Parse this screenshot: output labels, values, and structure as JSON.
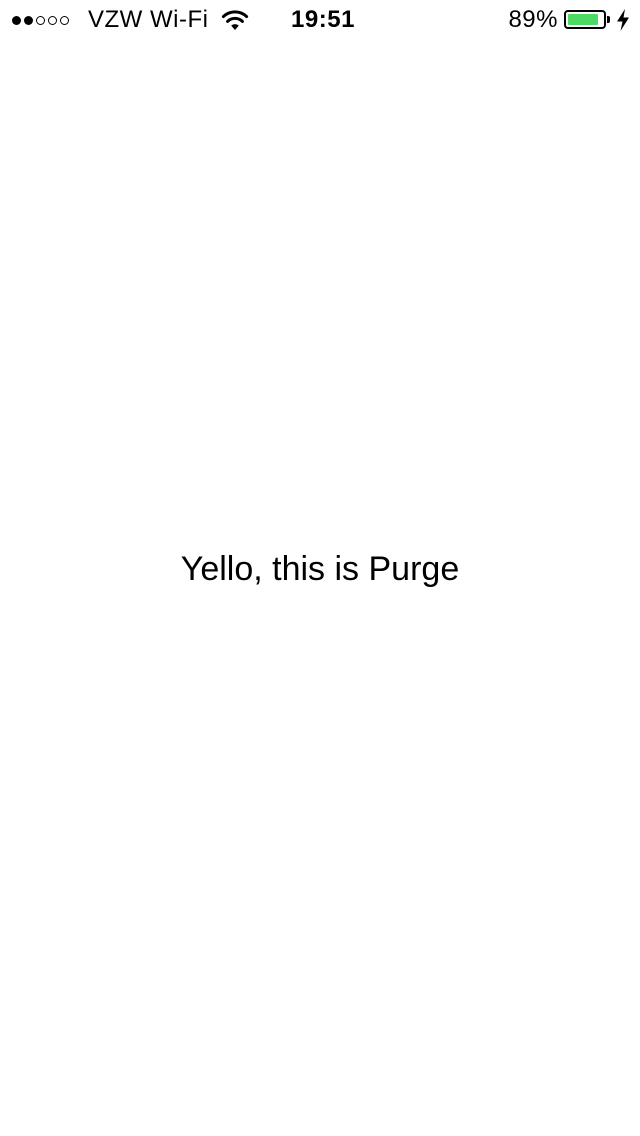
{
  "status_bar": {
    "signal": {
      "filled": 2,
      "total": 5
    },
    "carrier": "VZW Wi-Fi",
    "time": "19:51",
    "battery_percent": "89%",
    "battery_level": 0.89,
    "battery_color": "#4cd964",
    "charging": true,
    "icons": [
      "wifi-icon",
      "battery-icon",
      "charging-bolt-icon"
    ]
  },
  "main": {
    "message": "Yello, this is Purge"
  }
}
